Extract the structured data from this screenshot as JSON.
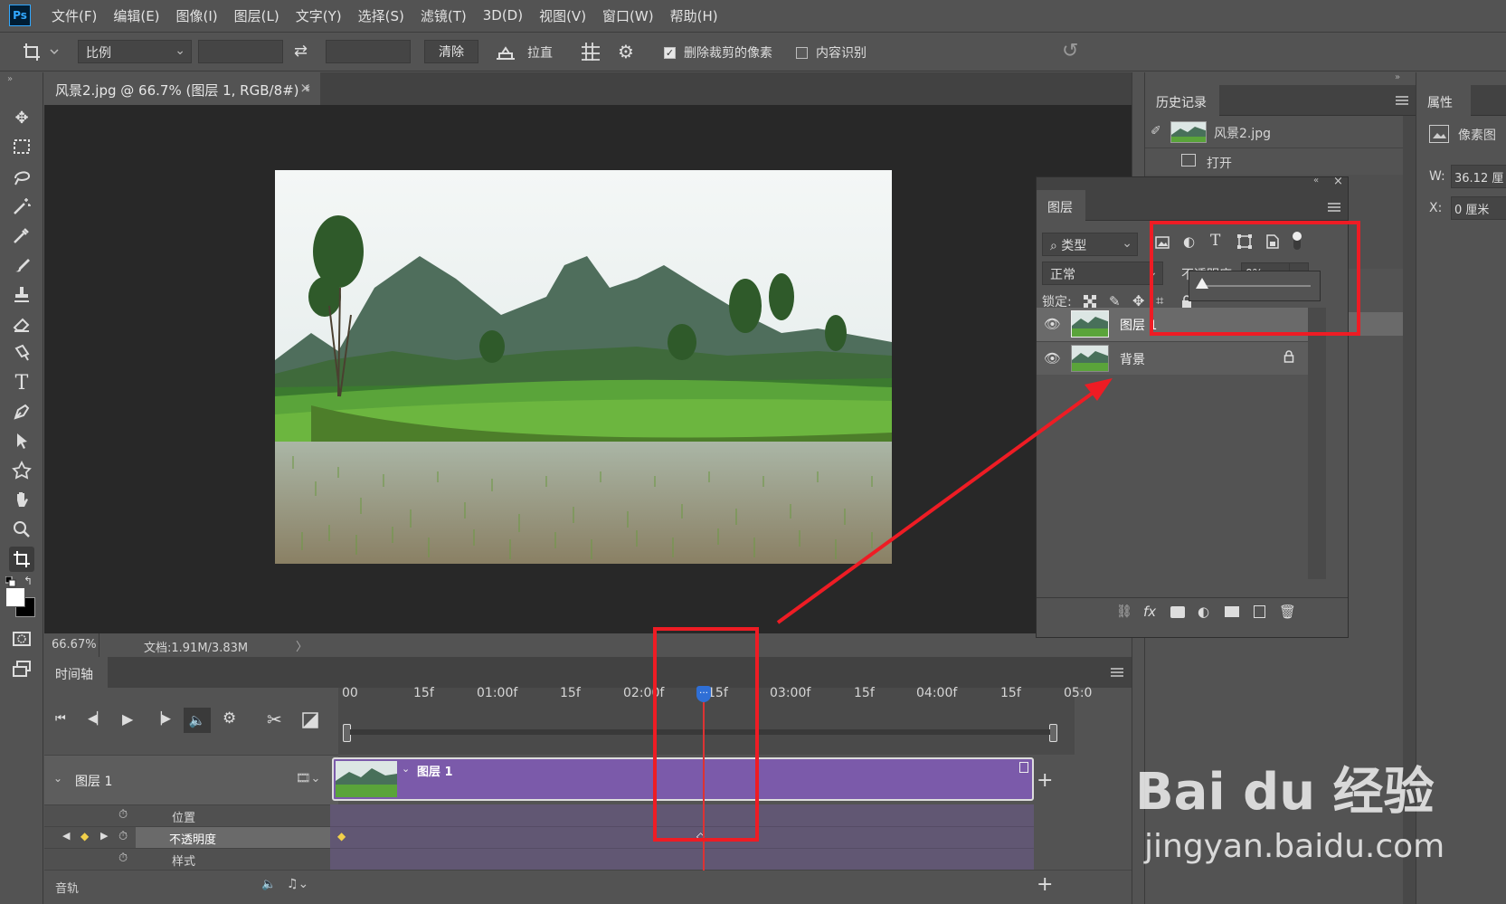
{
  "app": {
    "logo": "Ps",
    "menu": [
      "文件(F)",
      "编辑(E)",
      "图像(I)",
      "图层(L)",
      "文字(Y)",
      "选择(S)",
      "滤镜(T)",
      "3D(D)",
      "视图(V)",
      "窗口(W)",
      "帮助(H)"
    ]
  },
  "options": {
    "ratio_value": "比例",
    "clear_label": "清除",
    "straighten_label": "拉直",
    "delete_cropped_label": "删除裁剪的像素",
    "delete_cropped_checked": true,
    "content_aware_label": "内容识别",
    "content_aware_checked": false
  },
  "document": {
    "tab_title": "风景2.jpg @ 66.7% (图层 1, RGB/8#) *",
    "close": "×",
    "zoom": "66.67%",
    "doc_info": "文档:1.91M/3.83M",
    "arrow": "〉"
  },
  "history": {
    "tab": "历史记录",
    "snapshot_label": "风景2.jpg",
    "step_open": "打开"
  },
  "properties": {
    "tab": "属性",
    "type_label": "像素图",
    "w_label": "W:",
    "w_value": "36.12 厘",
    "x_label": "X:",
    "x_value": "0 厘米"
  },
  "layers": {
    "tab": "图层",
    "filter_kind": "类型",
    "blend_mode": "正常",
    "opacity_label": "不透明度:",
    "opacity_value": "0%",
    "opacity_slider": 0.0,
    "lock_label": "锁定:",
    "items": [
      {
        "name": "图层 1",
        "visible": true,
        "locked": false,
        "selected": true
      },
      {
        "name": "背景",
        "visible": true,
        "locked": true,
        "selected": false
      }
    ],
    "footer_fx": "fx"
  },
  "timeline": {
    "tab": "时间轴",
    "ruler": [
      "00",
      "15f",
      "01:00f",
      "15f",
      "02:00f",
      "15f",
      "03:00f",
      "15f",
      "04:00f",
      "15f",
      "05:0"
    ],
    "playhead_label": "…",
    "track_name": "图层 1",
    "clip_label": "图层 1",
    "props": [
      "位置",
      "不透明度",
      "样式"
    ],
    "audio_label": "音轨",
    "add": "+"
  },
  "watermark": {
    "brand": "Bai du 经验",
    "url": "jingyan.baidu.com"
  },
  "colors": {
    "accent_red": "#ee1c24",
    "clip_purple": "#7b5aaa",
    "track_purple": "#615773",
    "playhead_blue": "#2f6fd6"
  }
}
